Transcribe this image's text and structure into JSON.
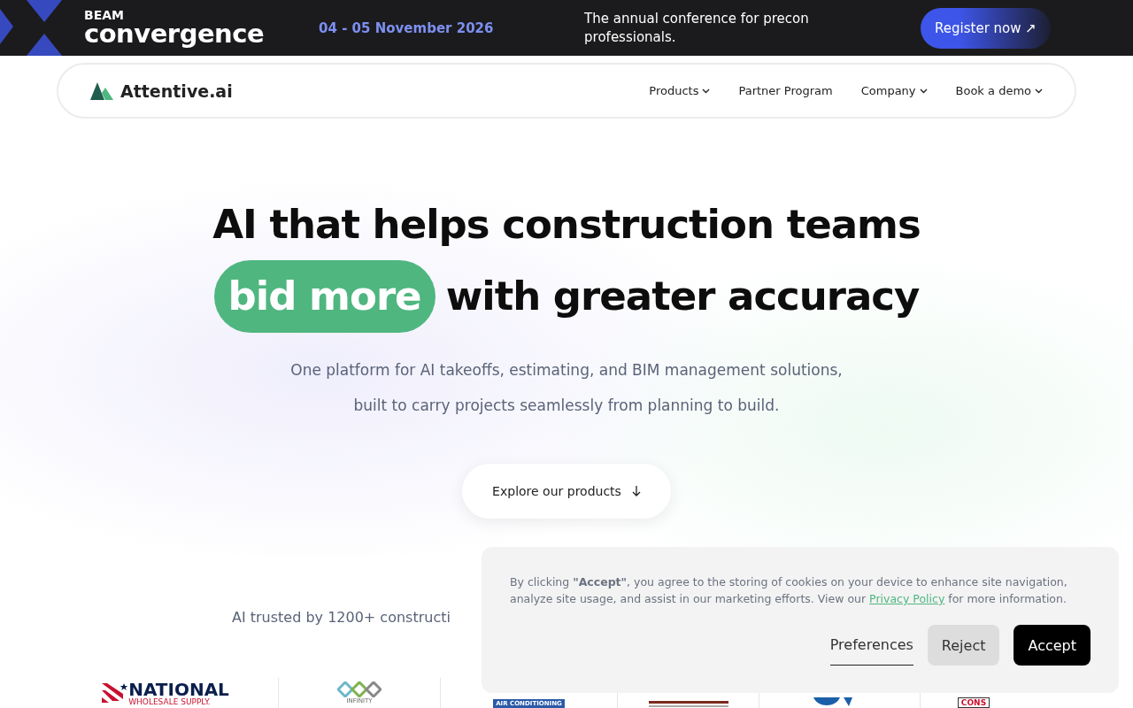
{
  "promo_bar": {
    "brand_top": "BEAM",
    "brand_name": "convergence",
    "date": "04 - 05 November 2026",
    "tagline": "The annual conference for precon professionals.",
    "cta": "Register now ↗"
  },
  "nav": {
    "logo": "Attentive.ai",
    "items": [
      {
        "label": "Products",
        "dropdown": true
      },
      {
        "label": "Partner Program",
        "dropdown": false
      },
      {
        "label": "Company",
        "dropdown": true
      },
      {
        "label": "Book a demo",
        "dropdown": true
      }
    ]
  },
  "hero": {
    "title_line": "AI that helps construction teams",
    "highlight": "bid more",
    "title_rest": "with greater accuracy",
    "subtitle_lines": [
      "One platform for AI takeoffs, estimating, and BIM management solutions,",
      "built to carry projects seamlessly from planning to build."
    ],
    "cta": "Explore our products"
  },
  "trusted": {
    "heading": "AI trusted by 1200+ constructi",
    "logos": [
      {
        "kind": "national",
        "name": "NATIONAL",
        "sub": "WHOLESALE SUPPLY."
      },
      {
        "kind": "infinity",
        "name": "INFINITY"
      },
      {
        "kind": "aircon",
        "name": "AIR CONDITIONING"
      },
      {
        "kind": "axion"
      },
      {
        "kind": "round"
      },
      {
        "kind": "cons",
        "name": "CONS"
      }
    ]
  },
  "cookie_banner": {
    "text": "By clicking **\"Accept\"**, you agree to the storing of cookies on your device to enhance site navigation, analyze site usage, and assist in our marketing efforts. View our",
    "link": "Privacy Policy",
    "text_end": "for more information.",
    "buttons": [
      {
        "kind": "link",
        "label": "Preferences"
      },
      {
        "kind": "secondary",
        "label": "Reject"
      },
      {
        "kind": "primary",
        "label": "Accept"
      }
    ]
  }
}
